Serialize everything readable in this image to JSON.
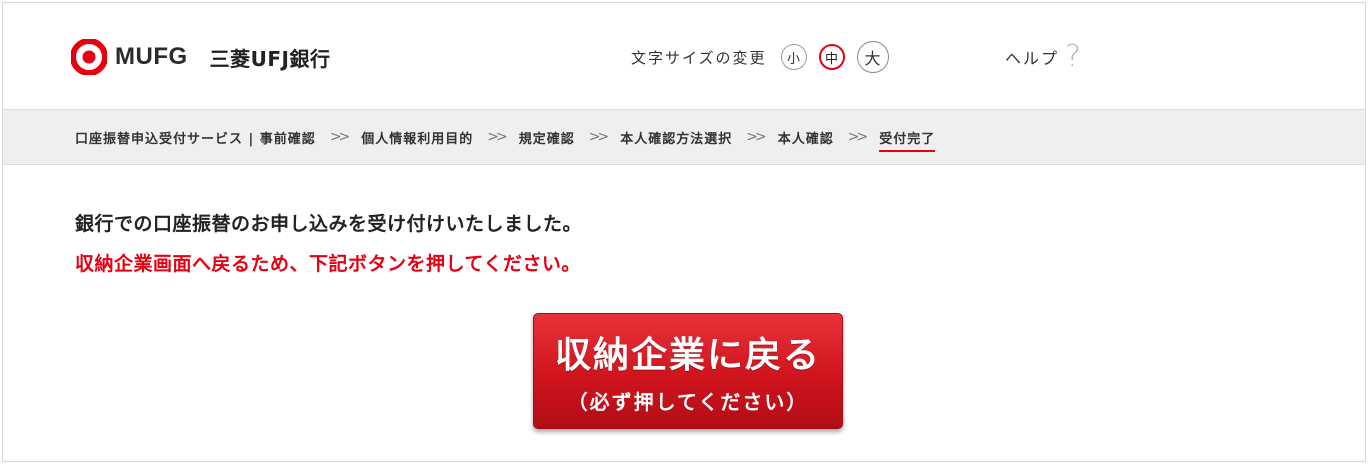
{
  "header": {
    "logo_text": "MUFG",
    "bank_name": "三菱UFJ銀行",
    "font_size": {
      "label": "文字サイズの変更",
      "small": "小",
      "medium": "中",
      "large": "大",
      "selected": "medium"
    },
    "help": {
      "label": "ヘルプ",
      "icon_glyph": "?"
    }
  },
  "breadcrumb": {
    "separator": ">>",
    "steps": [
      "口座振替申込受付サービス | 事前確認",
      "個人情報利用目的",
      "規定確認",
      "本人確認方法選択",
      "本人確認",
      "受付完了"
    ],
    "current": "受付完了"
  },
  "main": {
    "message_primary": "銀行での口座振替のお申し込みを受け付けいたしました。",
    "message_notice": "収納企業画面へ戻るため、下記ボタンを押してください。",
    "return_button": {
      "label": "収納企業に戻る",
      "sub_label": "（必ず押してください）"
    }
  },
  "colors": {
    "brand_red": "#e60012",
    "button_red": "#d0141d",
    "crumb_bar_bg": "#efefef"
  },
  "icons": {
    "logo": "mufg-logo-icon",
    "help": "help-question-icon",
    "separator": "double-chevron-right-icon"
  }
}
